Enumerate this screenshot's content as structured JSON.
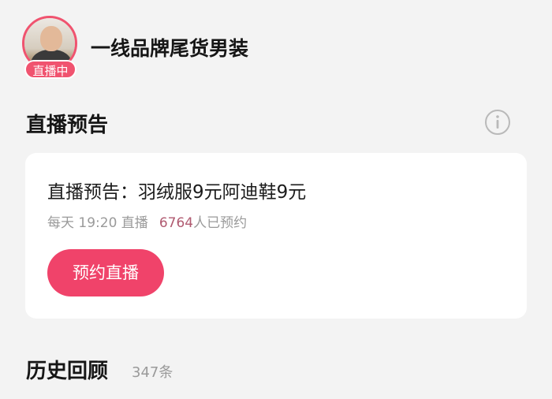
{
  "header": {
    "avatar_icon": "avatar-photo",
    "live_badge": "直播中",
    "shop_name": "一线品牌尾货男装"
  },
  "section": {
    "title": "直播预告",
    "info_icon": "info-icon"
  },
  "card": {
    "title": "直播预告：羽绒服9元阿迪鞋9元",
    "schedule": "每天 19:20 直播",
    "reservation_count": "6764",
    "reservation_suffix": "人已预约",
    "button_label": "预约直播"
  },
  "history": {
    "title": "历史回顾",
    "count": "347条"
  },
  "colors": {
    "accent": "#f0436a",
    "count_text": "#b05a70",
    "background": "#f3f3f3",
    "card": "#ffffff"
  }
}
